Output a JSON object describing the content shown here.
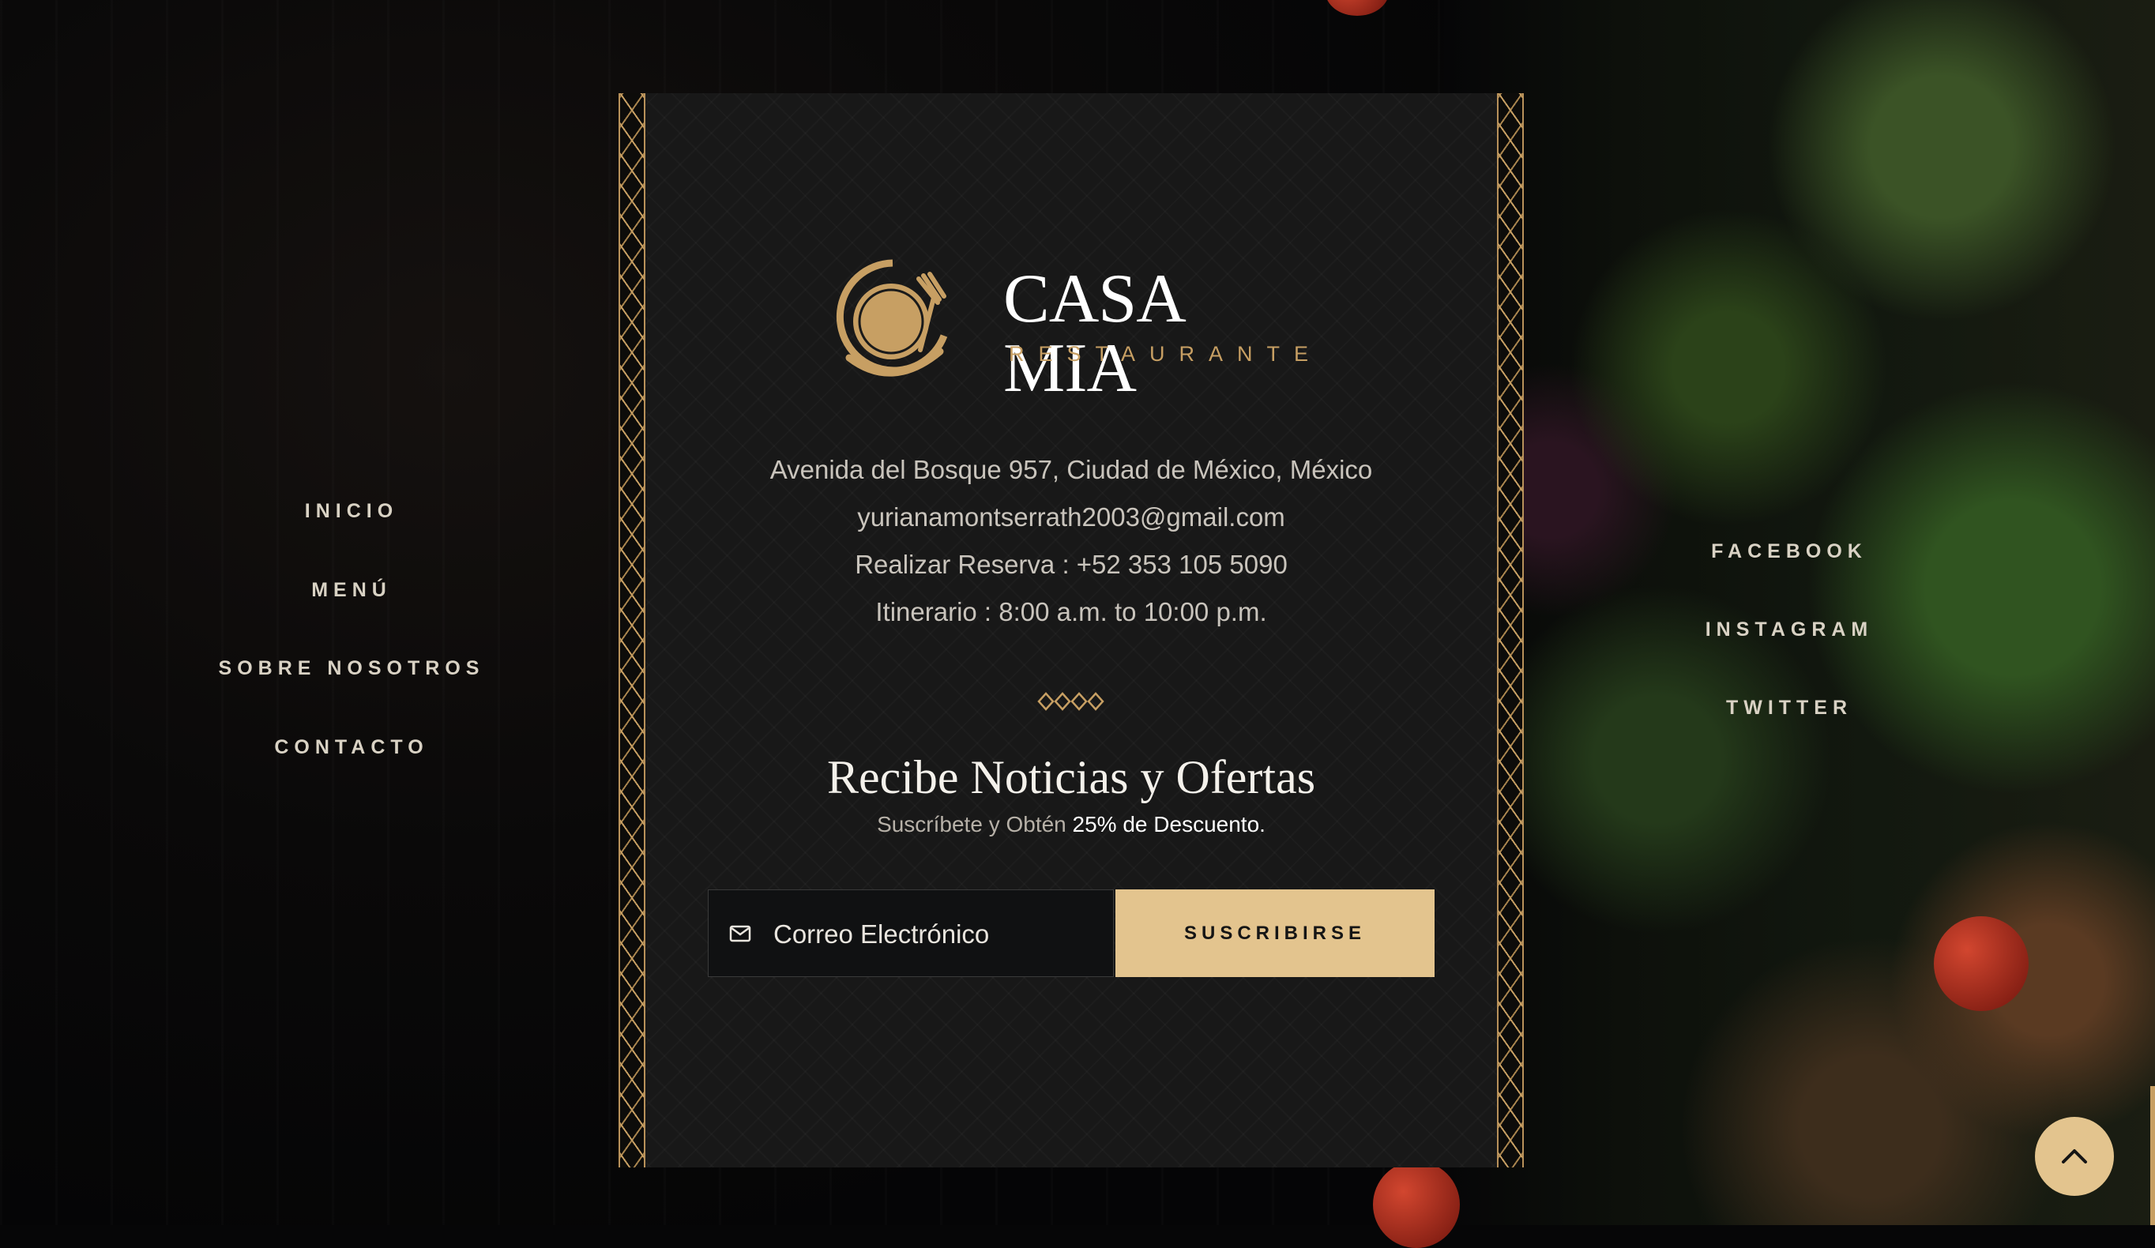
{
  "brand": {
    "name": "CASA MIA",
    "tagline": "RESTAURANTE",
    "logo_icon": "plate-with-fork-logo",
    "accent_color": "#c79f63",
    "button_color": "#e3c48e"
  },
  "nav_left": [
    {
      "label": "INICIO"
    },
    {
      "label": "MENÚ"
    },
    {
      "label": "SOBRE NOSOTROS"
    },
    {
      "label": "CONTACTO"
    }
  ],
  "nav_right": [
    {
      "label": "FACEBOOK"
    },
    {
      "label": "INSTAGRAM"
    },
    {
      "label": "TWITTER"
    }
  ],
  "contact": {
    "address": "Avenida del Bosque 957, Ciudad de México, México",
    "email": "yurianamontserrath2003@gmail.com",
    "reservation": "Realizar Reserva : +52 353 105 5090",
    "hours": "Itinerario : 8:00 a.m. to 10:00 p.m."
  },
  "newsletter": {
    "title": "Recibe Noticias y Ofertas",
    "subtitle_prefix": "Suscríbete y Obtén ",
    "subtitle_highlight": "25% de Descuento.",
    "email_placeholder": "Correo Electrónico",
    "email_icon": "mail-icon",
    "button_label": "SUSCRIBIRSE"
  },
  "back_to_top_icon": "chevron-up-icon"
}
